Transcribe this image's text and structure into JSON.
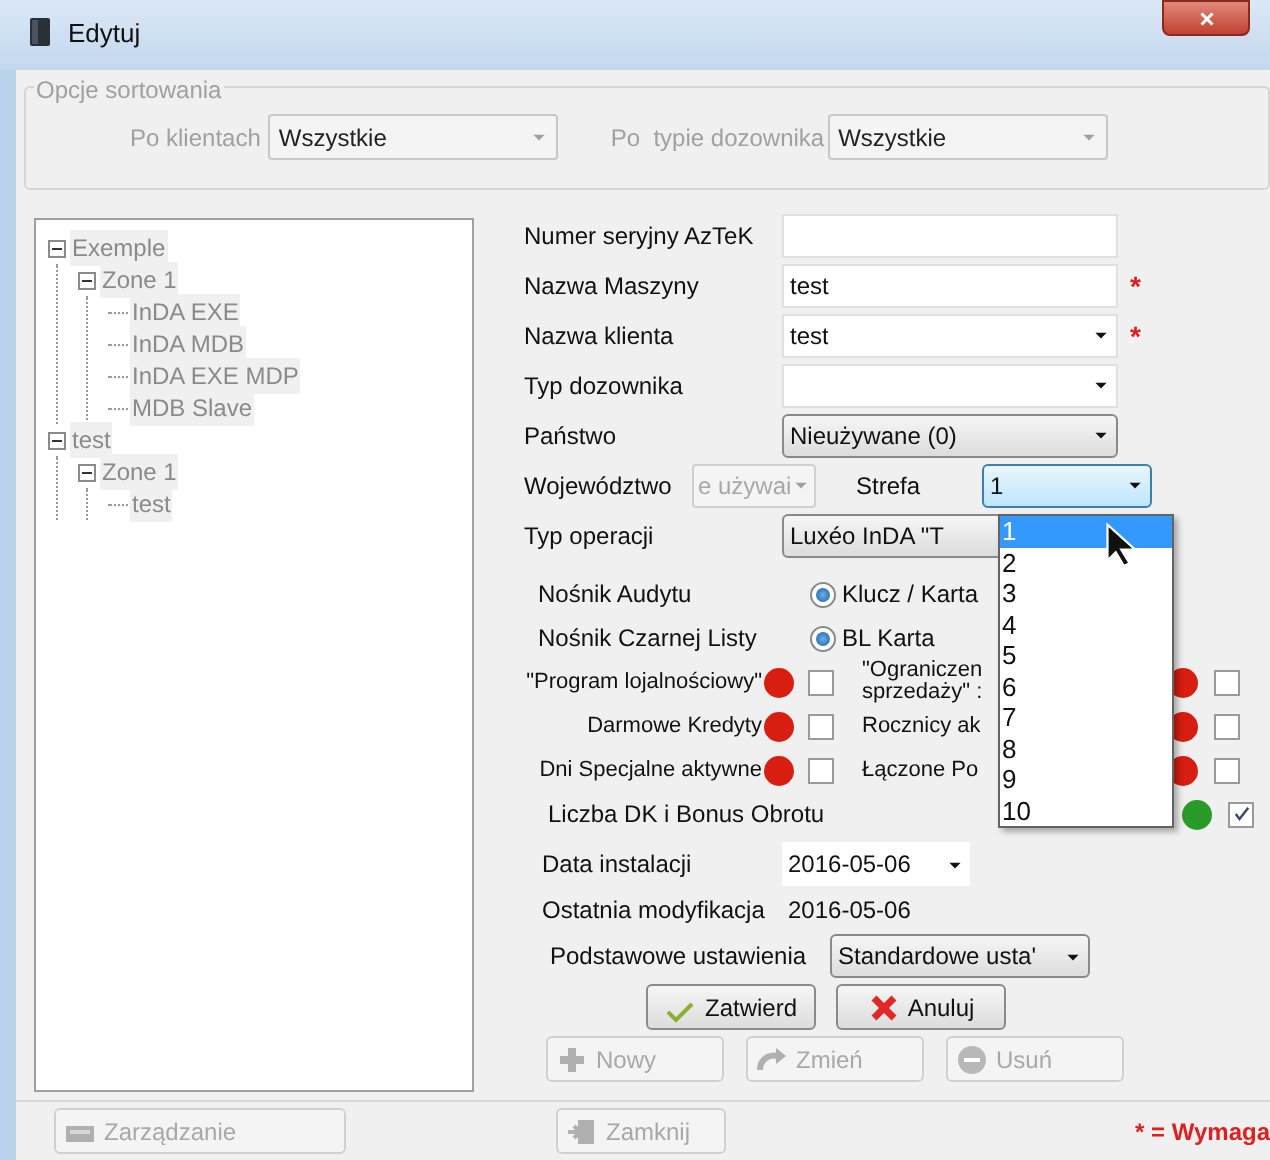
{
  "window": {
    "title": "Edytuj"
  },
  "sorting": {
    "title": "Opcje sortowania",
    "filters": [
      {
        "label": "Po klientach",
        "value": "Wszystkie"
      },
      {
        "label": "Po  typie dozownika",
        "value": "Wszystkie"
      }
    ]
  },
  "tree": [
    {
      "label": "Exemple",
      "expanded": true,
      "children": [
        {
          "label": "Zone 1",
          "expanded": true,
          "children": [
            {
              "label": "InDA EXE"
            },
            {
              "label": "InDA MDB"
            },
            {
              "label": "InDA EXE MDP"
            },
            {
              "label": "MDB Slave"
            }
          ]
        }
      ]
    },
    {
      "label": "test",
      "expanded": true,
      "children": [
        {
          "label": "Zone 1",
          "expanded": true,
          "children": [
            {
              "label": "test"
            }
          ]
        }
      ]
    }
  ],
  "fields": [
    {
      "label": "Numer seryjny AzTeK",
      "kind": "text"
    },
    {
      "label": "Nazwa Maszyny",
      "kind": "text",
      "value": "test",
      "mark": "*"
    },
    {
      "label": "Nazwa klienta",
      "kind": "dropdown",
      "value": "test",
      "mark": "*"
    },
    {
      "label": "Typ dozownika",
      "kind": "dropdown"
    },
    {
      "label": "Państwo",
      "kind": "select",
      "value": "Nieużywane (0)"
    }
  ],
  "region": {
    "label": "Województwo",
    "value": "e używai",
    "disabled": true
  },
  "zone": {
    "label": "Strefa",
    "value": "1",
    "open": true,
    "options": [
      {
        "label": "1",
        "selected": true
      },
      {
        "label": "2",
        "selected": false
      },
      {
        "label": "3",
        "selected": false
      },
      {
        "label": "4",
        "selected": false
      },
      {
        "label": "5",
        "selected": false
      },
      {
        "label": "6",
        "selected": false
      },
      {
        "label": "7",
        "selected": false
      },
      {
        "label": "8",
        "selected": false
      },
      {
        "label": "9",
        "selected": false
      },
      {
        "label": "10",
        "selected": false
      }
    ]
  },
  "operation": {
    "label": "Typ operacji",
    "value": "Luxéo InDA \"T"
  },
  "media": [
    {
      "label": "Nośnik Audytu",
      "option": "Klucz / Karta",
      "selected": true
    },
    {
      "label": "Nośnik Czarnej Listy",
      "option": "BL Karta",
      "selected": true
    }
  ],
  "features_left": [
    {
      "label": "\"Program lojalnościowy\"",
      "color": "#d81e10",
      "checked": false
    },
    {
      "label": "Darmowe Kredyty",
      "color": "#d81e10",
      "checked": false
    },
    {
      "label": "Dni Specjalne aktywne",
      "color": "#d81e10",
      "checked": false
    }
  ],
  "features_right": [
    {
      "label": "\"Ograniczen sprzedaży\" :",
      "color": "#d81e10",
      "checked": false
    },
    {
      "label": "Rocznicy ak",
      "color": "#d81e10",
      "checked": false
    },
    {
      "label": "Łączone Po",
      "color": "#d81e10",
      "checked": false
    }
  ],
  "bonus": {
    "label": "Liczba DK i Bonus Obrotu",
    "color": "#2a9a2a",
    "checked": true
  },
  "install_date": {
    "label": "Data instalacji",
    "value": "2016-05-06"
  },
  "last_modified": {
    "label": "Ostatnia modyfikacja",
    "value": "2016-05-06"
  },
  "defaults": {
    "label": "Podstawowe ustawienia",
    "value": "Standardowe usta'"
  },
  "actions": [
    {
      "label": "Zatwierd",
      "disabled": false
    },
    {
      "label": "Anuluj",
      "disabled": false
    }
  ],
  "record_actions": [
    {
      "label": "Nowy",
      "disabled": true
    },
    {
      "label": "Zmień",
      "disabled": true
    },
    {
      "label": "Usuń",
      "disabled": true
    }
  ],
  "footer": {
    "buttons": [
      {
        "label": "Zarządzanie",
        "disabled": true
      },
      {
        "label": "Zamknij",
        "disabled": true
      }
    ],
    "note": "* = Wymaga"
  }
}
